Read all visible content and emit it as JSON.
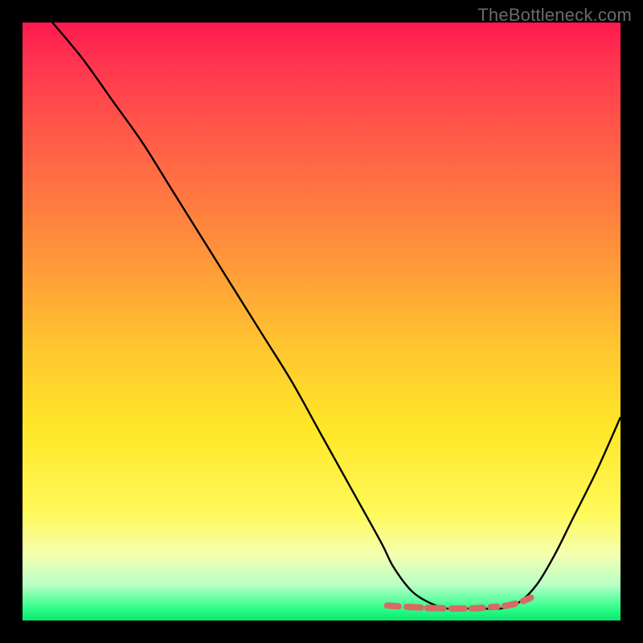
{
  "watermark": "TheBottleneck.com",
  "chart_data": {
    "type": "line",
    "title": "",
    "xlabel": "",
    "ylabel": "",
    "xlim": [
      0,
      100
    ],
    "ylim": [
      0,
      100
    ],
    "series": [
      {
        "name": "bottleneck-curve",
        "x": [
          5,
          10,
          15,
          20,
          25,
          30,
          35,
          40,
          45,
          50,
          55,
          60,
          62,
          65,
          68,
          71,
          74,
          77,
          80,
          83,
          86,
          89,
          92,
          96,
          100
        ],
        "y": [
          100,
          94,
          87,
          80,
          72,
          64,
          56,
          48,
          40,
          31,
          22,
          13,
          9,
          5,
          3,
          2,
          2,
          2,
          2,
          3,
          6,
          11,
          17,
          25,
          34
        ]
      }
    ],
    "markers": {
      "name": "optimal-segment",
      "color": "#d86a66",
      "x": [
        61,
        64,
        66,
        68,
        70,
        72,
        74,
        76,
        78,
        81,
        83,
        85
      ],
      "y": [
        2.5,
        2.3,
        2.2,
        2.1,
        2.05,
        2.0,
        2.0,
        2.05,
        2.2,
        2.5,
        3.0,
        3.8
      ]
    },
    "gradient": {
      "top": "#ff1a4f",
      "bottom": "#08e86e"
    }
  }
}
